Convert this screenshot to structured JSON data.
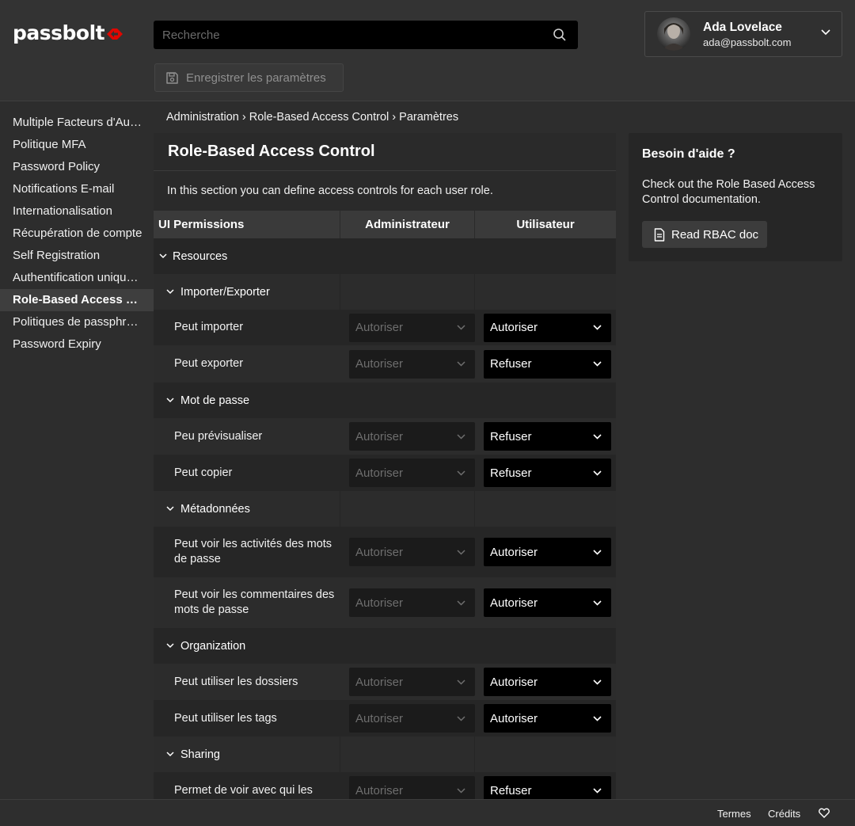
{
  "brand": {
    "logo_text": "passbolt",
    "accent": "#e10600"
  },
  "search": {
    "placeholder": "Recherche",
    "icon": "search-icon"
  },
  "user": {
    "name": "Ada Lovelace",
    "email": "ada@passbolt.com"
  },
  "toolbar": {
    "save_label": "Enregistrer les paramètres"
  },
  "sidebar": {
    "items": [
      {
        "label": "Multiple Facteurs d'Authentification"
      },
      {
        "label": "Politique MFA"
      },
      {
        "label": "Password Policy"
      },
      {
        "label": "Notifications E-mail"
      },
      {
        "label": "Internationalisation"
      },
      {
        "label": "Récupération de compte"
      },
      {
        "label": "Self Registration"
      },
      {
        "label": "Authentification unique (SSO)"
      },
      {
        "label": "Role-Based Access Control"
      },
      {
        "label": "Politiques de passphrase"
      },
      {
        "label": "Password Expiry"
      }
    ]
  },
  "breadcrumb": {
    "text": "Administration › Role-Based Access Control › Paramètres"
  },
  "main": {
    "title": "Role-Based Access Control",
    "intro": "In this section you can define access controls for each user role.",
    "headers": {
      "permissions": "UI Permissions",
      "admin": "Administrateur",
      "user": "Utilisateur"
    },
    "root_group": "Resources",
    "groups": [
      {
        "label": "Importer/Exporter",
        "rows": [
          {
            "label": "Peut importer",
            "admin": "Autoriser",
            "user": "Autoriser"
          },
          {
            "label": "Peut exporter",
            "admin": "Autoriser",
            "user": "Refuser"
          }
        ]
      },
      {
        "label": "Mot de passe",
        "rows": [
          {
            "label": "Peu prévisualiser",
            "admin": "Autoriser",
            "user": "Refuser"
          },
          {
            "label": "Peut copier",
            "admin": "Autoriser",
            "user": "Refuser"
          }
        ]
      },
      {
        "label": "Métadonnées",
        "rows": [
          {
            "label": "Peut voir les activités des mots de passe",
            "admin": "Autoriser",
            "user": "Autoriser"
          },
          {
            "label": "Peut voir les commentaires des mots de passe",
            "admin": "Autoriser",
            "user": "Autoriser"
          }
        ]
      },
      {
        "label": "Organization",
        "rows": [
          {
            "label": "Peut utiliser les dossiers",
            "admin": "Autoriser",
            "user": "Autoriser"
          },
          {
            "label": "Peut utiliser les tags",
            "admin": "Autoriser",
            "user": "Autoriser"
          }
        ]
      },
      {
        "label": "Sharing",
        "rows": [
          {
            "label": "Permet de voir avec qui les",
            "admin": "Autoriser",
            "user": "Refuser"
          }
        ]
      }
    ]
  },
  "help": {
    "title": "Besoin d'aide ?",
    "text": "Check out the Role Based Access Control documentation.",
    "button_label": "Read RBAC doc"
  },
  "footer": {
    "terms": "Termes",
    "credits": "Crédits"
  }
}
